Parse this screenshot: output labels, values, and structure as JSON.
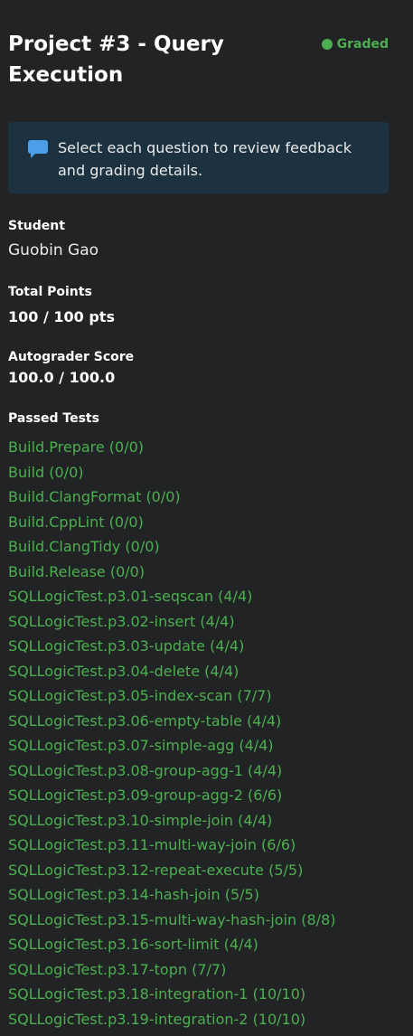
{
  "header": {
    "title_line1": "Project #3 - Query",
    "title_line2": "Execution",
    "status_label": "Graded",
    "status_color": "#4caf50"
  },
  "info": {
    "icon": "chat-bubble-icon",
    "message_line1": "Select each question to review feedback",
    "message_line2": "and grading details."
  },
  "student": {
    "label": "Student",
    "value": "Guobin Gao"
  },
  "total_points": {
    "label": "Total Points",
    "value": "100 / 100 pts"
  },
  "autograder": {
    "label": "Autograder Score",
    "value": "100.0 / 100.0"
  },
  "passed_tests": {
    "label": "Passed Tests",
    "color": "#4caf50",
    "items": [
      "Build.Prepare (0/0)",
      "Build (0/0)",
      "Build.ClangFormat (0/0)",
      "Build.CppLint (0/0)",
      "Build.ClangTidy (0/0)",
      "Build.Release (0/0)",
      "SQLLogicTest.p3.01-seqscan (4/4)",
      "SQLLogicTest.p3.02-insert (4/4)",
      "SQLLogicTest.p3.03-update (4/4)",
      "SQLLogicTest.p3.04-delete (4/4)",
      "SQLLogicTest.p3.05-index-scan (7/7)",
      "SQLLogicTest.p3.06-empty-table (4/4)",
      "SQLLogicTest.p3.07-simple-agg (4/4)",
      "SQLLogicTest.p3.08-group-agg-1 (4/4)",
      "SQLLogicTest.p3.09-group-agg-2 (6/6)",
      "SQLLogicTest.p3.10-simple-join (4/4)",
      "SQLLogicTest.p3.11-multi-way-join (6/6)",
      "SQLLogicTest.p3.12-repeat-execute (5/5)",
      "SQLLogicTest.p3.14-hash-join (5/5)",
      "SQLLogicTest.p3.15-multi-way-hash-join (8/8)",
      "SQLLogicTest.p3.16-sort-limit (4/4)",
      "SQLLogicTest.p3.17-topn (7/7)",
      "SQLLogicTest.p3.18-integration-1 (10/10)",
      "SQLLogicTest.p3.19-integration-2 (10/10)"
    ]
  }
}
